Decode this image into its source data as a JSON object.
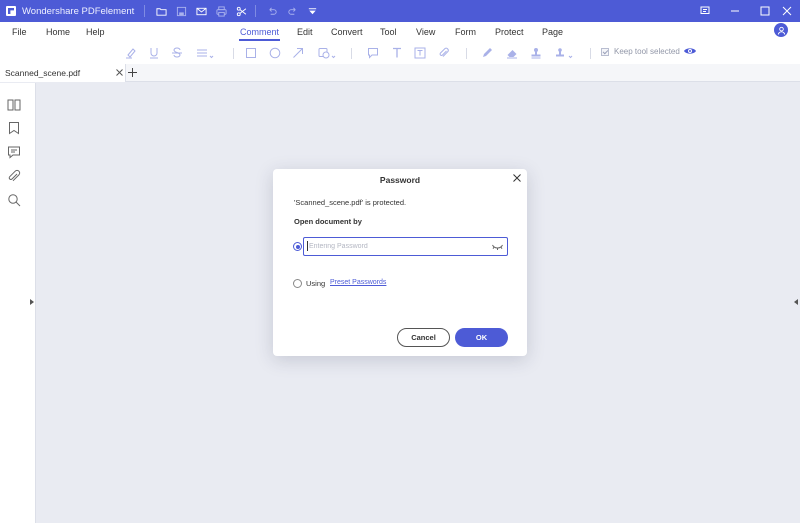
{
  "app": {
    "title": "Wondershare PDFelement"
  },
  "colors": {
    "accent": "#4d5bd6",
    "canvas": "#e9ebf2"
  },
  "quick_access": [
    {
      "name": "open-folder-icon"
    },
    {
      "name": "save-icon"
    },
    {
      "name": "mail-icon"
    },
    {
      "name": "print-icon"
    },
    {
      "name": "scissors-icon"
    },
    {
      "name": "undo-icon"
    },
    {
      "name": "redo-icon"
    },
    {
      "name": "customize-dropdown-icon"
    }
  ],
  "window_controls": [
    "feedback-icon",
    "minimize-icon",
    "maximize-icon",
    "close-icon"
  ],
  "menu": {
    "file": "File",
    "home": "Home",
    "help": "Help",
    "comment": "Comment",
    "edit": "Edit",
    "convert": "Convert",
    "tool": "Tool",
    "view": "View",
    "form": "Form",
    "protect": "Protect",
    "page": "Page",
    "active": "Comment"
  },
  "toolbar": {
    "tools": [
      "highlight-icon",
      "underline-icon",
      "strikethrough-icon",
      "line-style-dropdown-icon",
      "rectangle-icon",
      "oval-icon",
      "arrow-icon",
      "shapes-dropdown-icon",
      "sticky-note-icon",
      "text-icon",
      "text-box-icon",
      "attachment-icon",
      "pencil-icon",
      "eraser-icon",
      "stamp-icon",
      "signature-dropdown-icon"
    ],
    "keep_tool_selected": "Keep tool selected",
    "keep_tool_checked": true
  },
  "tabs": [
    {
      "label": "Scanned_scene.pdf"
    }
  ],
  "sidebar": [
    "thumbnails-icon",
    "bookmark-icon",
    "comments-icon",
    "attachment-icon",
    "search-icon"
  ],
  "dialog": {
    "title": "Password",
    "message": "'Scanned_scene.pdf' is protected.",
    "subtitle": "Open document by",
    "password_placeholder": "Entering Password",
    "password_value": "",
    "using_label": "Using",
    "preset_link": "Preset Passwords",
    "cancel_label": "Cancel",
    "ok_label": "OK",
    "selected_option": "password"
  }
}
